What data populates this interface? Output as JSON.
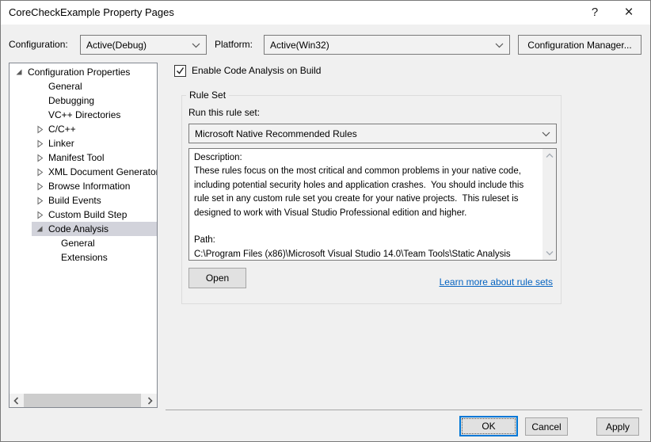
{
  "window": {
    "title": "CoreCheckExample Property Pages",
    "help_glyph": "?",
    "close_glyph": "×"
  },
  "toolbar": {
    "configuration_label": "Configuration:",
    "configuration_value": "Active(Debug)",
    "platform_label": "Platform:",
    "platform_value": "Active(Win32)",
    "config_manager_label": "Configuration Manager..."
  },
  "tree": {
    "items": [
      {
        "label": "Configuration Properties",
        "level": 0,
        "state": "expanded",
        "selected": false
      },
      {
        "label": "General",
        "level": 1,
        "state": "none",
        "selected": false
      },
      {
        "label": "Debugging",
        "level": 1,
        "state": "none",
        "selected": false
      },
      {
        "label": "VC++ Directories",
        "level": 1,
        "state": "none",
        "selected": false
      },
      {
        "label": "C/C++",
        "level": 1,
        "state": "collapsed",
        "selected": false
      },
      {
        "label": "Linker",
        "level": 1,
        "state": "collapsed",
        "selected": false
      },
      {
        "label": "Manifest Tool",
        "level": 1,
        "state": "collapsed",
        "selected": false
      },
      {
        "label": "XML Document Generator",
        "level": 1,
        "state": "collapsed",
        "selected": false
      },
      {
        "label": "Browse Information",
        "level": 1,
        "state": "collapsed",
        "selected": false
      },
      {
        "label": "Build Events",
        "level": 1,
        "state": "collapsed",
        "selected": false
      },
      {
        "label": "Custom Build Step",
        "level": 1,
        "state": "collapsed",
        "selected": false
      },
      {
        "label": "Code Analysis",
        "level": 1,
        "state": "expanded",
        "selected": true
      },
      {
        "label": "General",
        "level": 2,
        "state": "none",
        "selected": false
      },
      {
        "label": "Extensions",
        "level": 2,
        "state": "none",
        "selected": false
      }
    ]
  },
  "main": {
    "enable_label": "Enable Code Analysis on Build",
    "enable_checked": true,
    "rule_set": {
      "title": "Rule Set",
      "run_label": "Run this rule set:",
      "selected_rule_set": "Microsoft Native Recommended Rules",
      "description": "Description:\nThese rules focus on the most critical and common problems in your native code, including potential security holes and application crashes.  You should include this rule set in any custom rule set you create for your native projects.  This ruleset is designed to work with Visual Studio Professional edition and higher.\n\nPath:\nC:\\Program Files (x86)\\Microsoft Visual Studio 14.0\\Team Tools\\Static Analysis Tools\\Rule Sets\\NativeRecommendedRules.ruleset",
      "open_label": "Open",
      "learn_more_label": "Learn more about rule sets"
    }
  },
  "footer": {
    "ok_label": "OK",
    "cancel_label": "Cancel",
    "apply_label": "Apply"
  },
  "colors": {
    "accent": "#0078d7",
    "link": "#0563c1",
    "tree_selection": "#d2d3db",
    "dialog_bg": "#f0f0f0",
    "titlebar_bg": "#ffffff",
    "button_bg": "#e1e1e1"
  }
}
